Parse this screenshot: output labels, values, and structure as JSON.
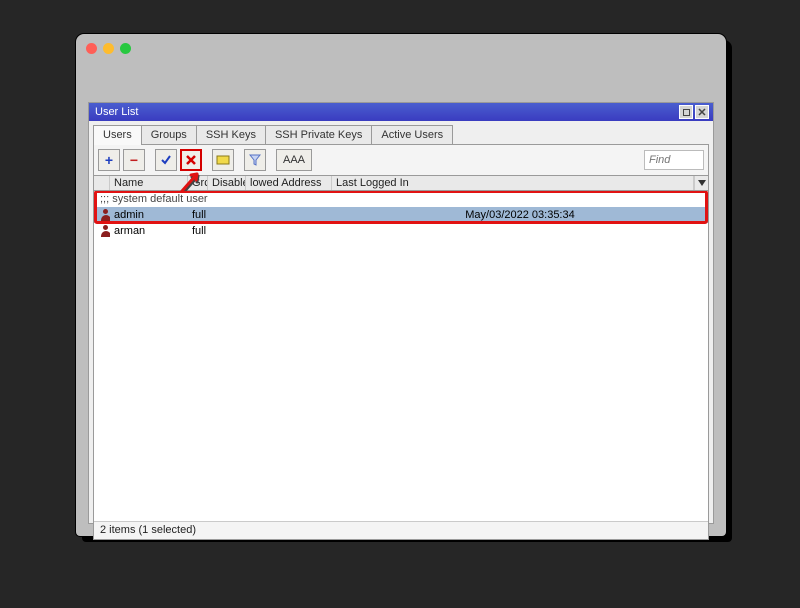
{
  "windowTitle": "User List",
  "tabs": [
    "Users",
    "Groups",
    "SSH Keys",
    "SSH Private Keys",
    "Active Users"
  ],
  "activeTab": 0,
  "aaaLabel": "AAA",
  "findPlaceholder": "Find",
  "columns": {
    "name": "Name",
    "group": "Grc",
    "disable": "Disable",
    "allowed": "lowed Address",
    "lastLogged": "Last Logged In"
  },
  "commentRow": ";;; system default user",
  "rows": [
    {
      "name": "admin",
      "group": "full",
      "lastLogged": "May/03/2022 03:35:34",
      "selected": true
    },
    {
      "name": "arman",
      "group": "full",
      "lastLogged": "",
      "selected": false
    }
  ],
  "status": "2 items (1 selected)"
}
